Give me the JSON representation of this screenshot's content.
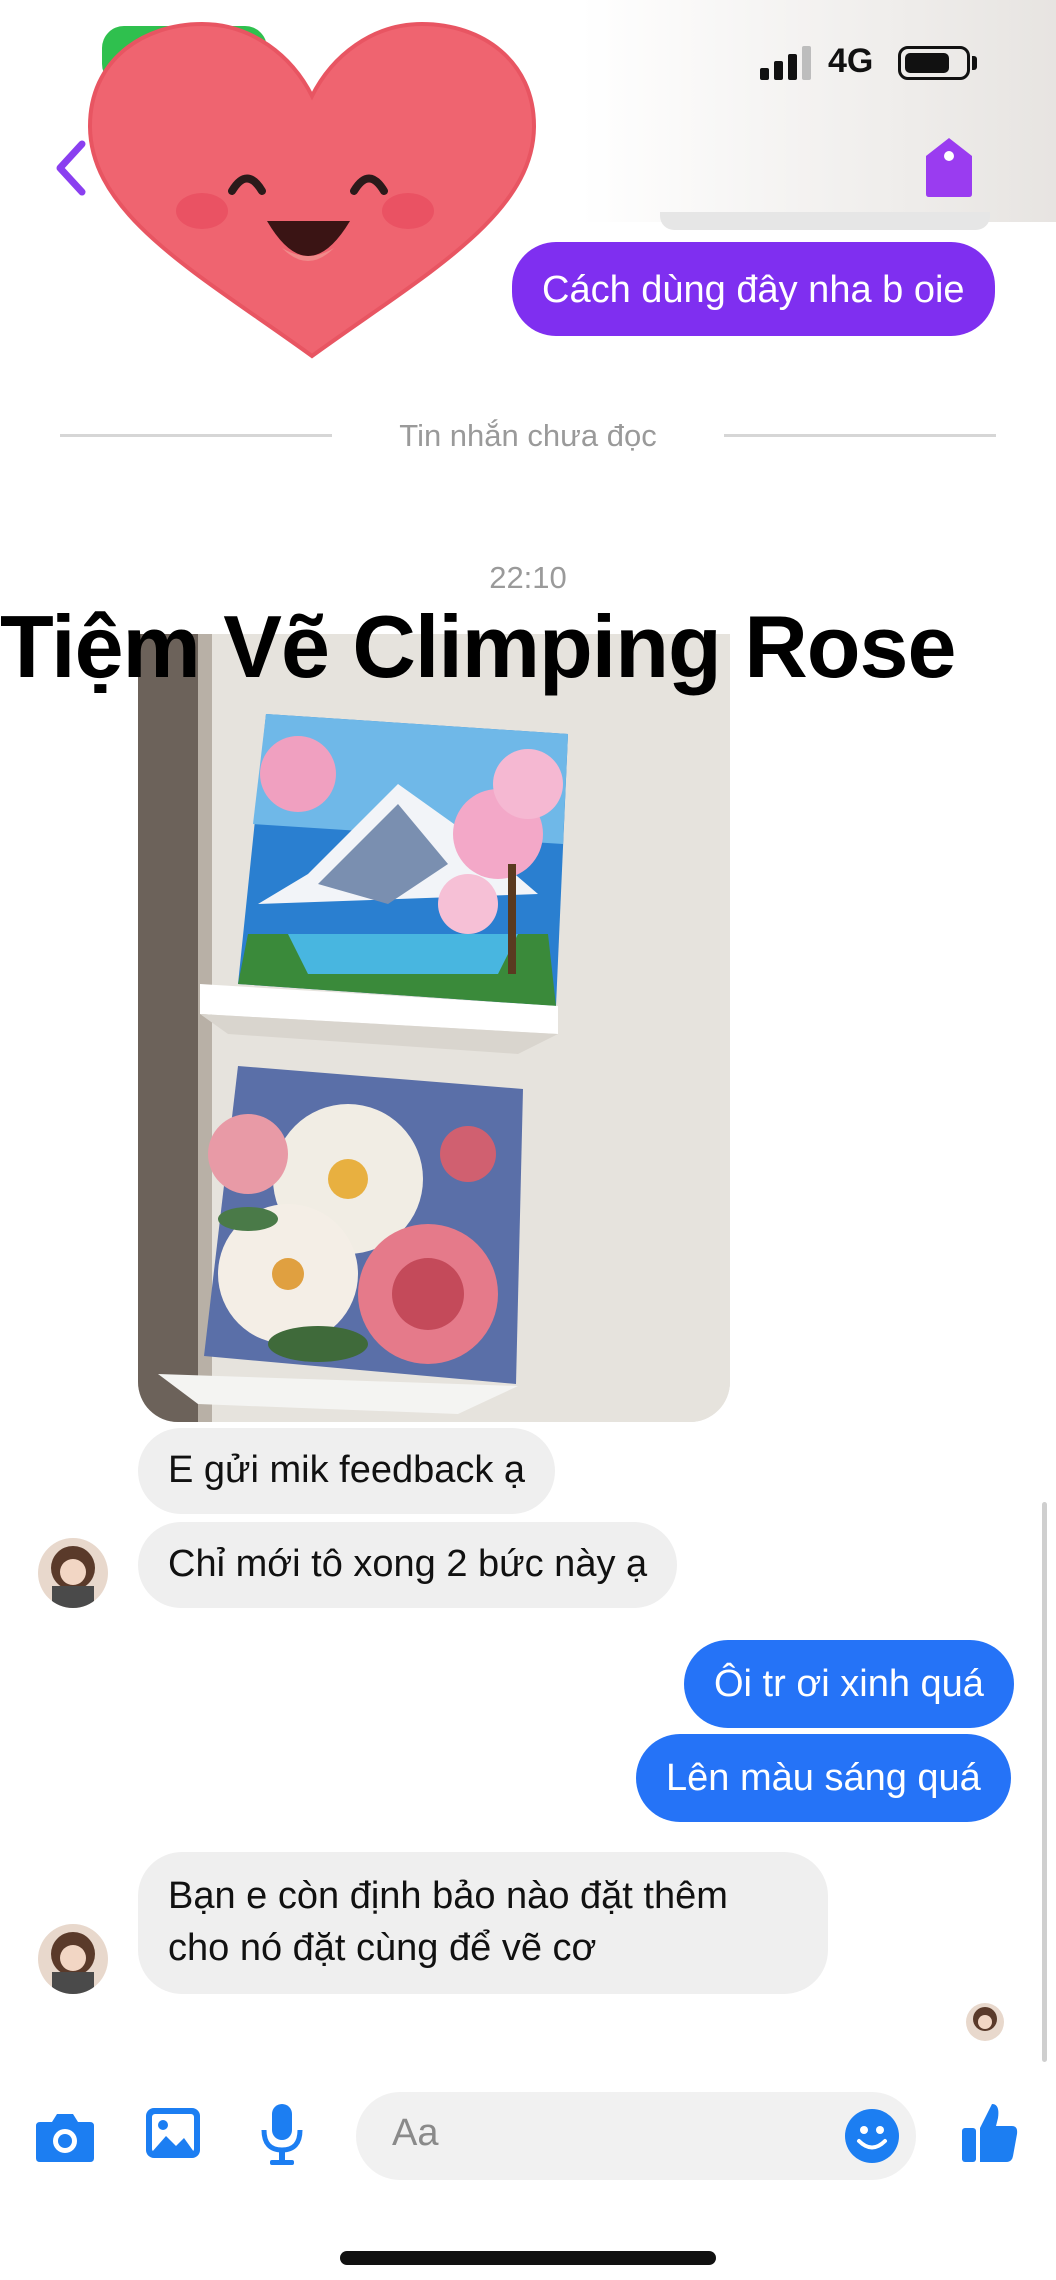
{
  "status_bar": {
    "network": "4G",
    "battery_level": 0.75
  },
  "colors": {
    "accent_purple": "#7f2ff0",
    "accent_blue": "#2573f7",
    "incoming_bubble": "#efefef",
    "divider_text": "#9a9a9a"
  },
  "header": {
    "back_icon": "chevron-left-icon",
    "tag_icon": "tag-icon"
  },
  "overlay": {
    "title": "Tiệm Vẽ Climping Rose"
  },
  "messages": {
    "outgoing_1": "Cách dùng đây nha b oie",
    "unread_divider": "Tin nhắn chưa đọc",
    "timestamp": "22:10",
    "incoming_1": "E gửi mik feedback ạ",
    "incoming_2": "Chỉ mới tô xong 2 bức này ạ",
    "outgoing_2": "Ôi tr ơi xinh quá",
    "outgoing_3": "Lên màu sáng quá",
    "incoming_3_line1": "Bạn e còn định bảo nào đặt thêm",
    "incoming_3_line2": "cho nó đặt cùng để vẽ cơ"
  },
  "composer": {
    "placeholder": "Aa",
    "icons": [
      "camera-icon",
      "image-icon",
      "microphone-icon",
      "emoji-icon",
      "like-icon"
    ]
  }
}
